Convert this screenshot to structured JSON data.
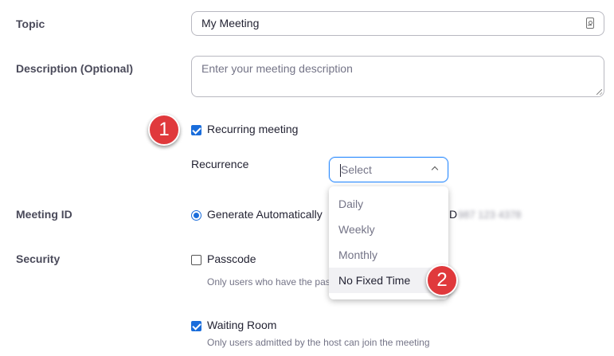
{
  "topic": {
    "label": "Topic",
    "value": "My Meeting"
  },
  "description": {
    "label": "Description (Optional)",
    "placeholder": "Enter your meeting description"
  },
  "recurring": {
    "label": "Recurring meeting",
    "checked": true
  },
  "recurrence": {
    "label": "Recurrence",
    "selected_placeholder": "Select",
    "options": [
      "Daily",
      "Weekly",
      "Monthly",
      "No Fixed Time"
    ],
    "hovered_option": "No Fixed Time"
  },
  "meeting_id": {
    "label": "Meeting ID",
    "option_label": "Generate Automatically",
    "partial_text": "D",
    "blurred_id": "987 123 4378"
  },
  "security": {
    "label": "Security",
    "passcode_label": "Passcode",
    "passcode_hint": "Only users who have the pass",
    "waiting_room_label": "Waiting Room",
    "waiting_room_hint": "Only users admitted by the host can join the meeting"
  },
  "steps": {
    "step1": "1",
    "step2": "2"
  },
  "colors": {
    "accent": "#1a6ddb",
    "badge": "#e0393c",
    "focus_border": "#2d8cff"
  }
}
